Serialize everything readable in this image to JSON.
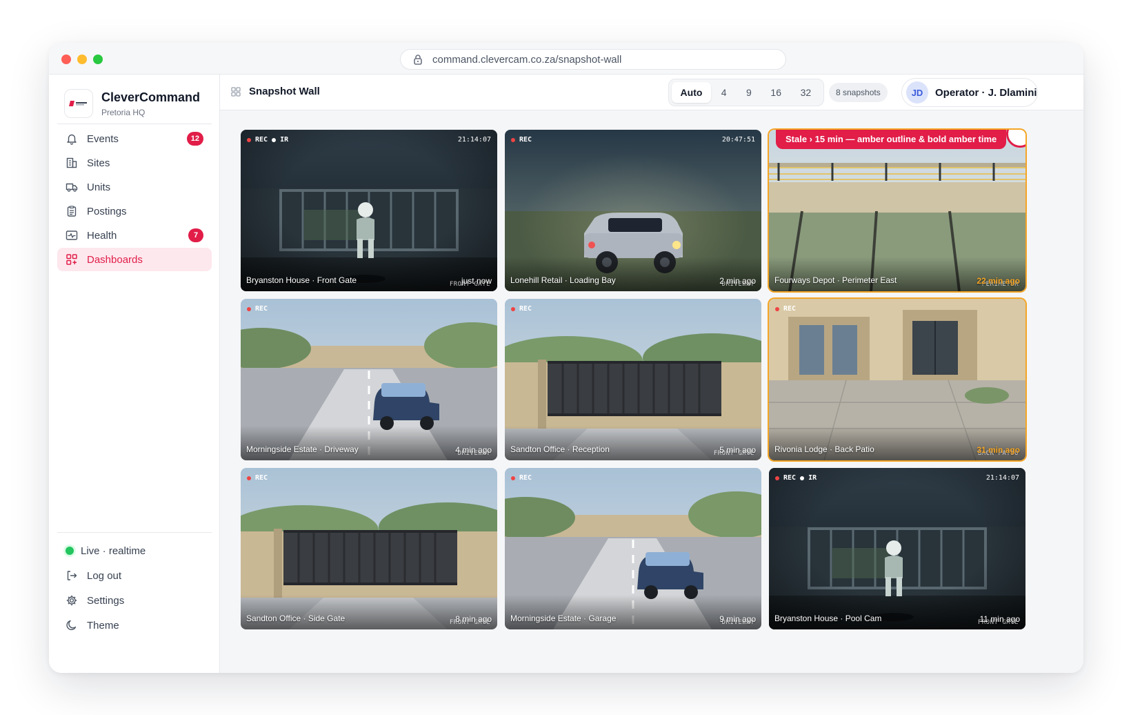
{
  "browser": {
    "url": "command.clevercam.co.za/snapshot-wall"
  },
  "brand": {
    "name": "CleverCommand",
    "subtitle": "Pretoria HQ"
  },
  "nav": [
    {
      "label": "Events",
      "icon": "bell-icon",
      "badge": "12",
      "active": false
    },
    {
      "label": "Sites",
      "icon": "building-icon",
      "badge": null,
      "active": false
    },
    {
      "label": "Units",
      "icon": "truck-icon",
      "badge": null,
      "active": false
    },
    {
      "label": "Postings",
      "icon": "clipboard-icon",
      "badge": null,
      "active": false
    },
    {
      "label": "Health",
      "icon": "pulse-icon",
      "badge": "7",
      "active": false
    },
    {
      "label": "Dashboards",
      "icon": "dashboard-grid-icon",
      "badge": null,
      "active": true
    }
  ],
  "footer": {
    "live": "Live · realtime",
    "logout": "Log out",
    "settings": "Settings",
    "theme": "Theme"
  },
  "page": {
    "title": "Snapshot Wall"
  },
  "layout_options": [
    "Auto",
    "4",
    "9",
    "16",
    "32"
  ],
  "layout_selected": "Auto",
  "snapshot_count": "8 snapshots",
  "operator": {
    "initials": "JD",
    "name": "Operator · J. Dlamini"
  },
  "stale_note": "Stale › 15 min — amber outline & bold amber time",
  "colors": {
    "accent": "#e11d48",
    "stale": "#f5a524",
    "live": "#22c55e"
  },
  "tiles": [
    {
      "name": "Bryanston House · Front Gate",
      "age": "just now",
      "zone": "FRONT GATE",
      "rec": "REC",
      "ir": "IR",
      "time": "21:14:07",
      "stale": false,
      "scene": "ir-gate"
    },
    {
      "name": "Lonehill Retail · Loading Bay",
      "age": "2 min ago",
      "zone": "DRIVEWAY",
      "rec": "REC",
      "ir": "",
      "time": "20:47:51",
      "stale": false,
      "scene": "night-car"
    },
    {
      "name": "Fourways Depot · Perimeter East",
      "age": "22 min ago",
      "zone": "PERIMETER",
      "rec": "",
      "ir": "",
      "time": "",
      "stale": true,
      "scene": "perimeter"
    },
    {
      "name": "Morningside Estate · Driveway",
      "age": "4 min ago",
      "zone": "DRIVEWAY",
      "rec": "REC",
      "ir": "",
      "time": "",
      "stale": false,
      "scene": "driveway"
    },
    {
      "name": "Sandton Office · Reception",
      "age": "5 min ago",
      "zone": "FRONT GATE",
      "rec": "REC",
      "ir": "",
      "time": "",
      "stale": false,
      "scene": "gate"
    },
    {
      "name": "Rivonia Lodge · Back Patio",
      "age": "31 min ago",
      "zone": "BACK PATIO",
      "rec": "REC",
      "ir": "",
      "time": "",
      "stale": true,
      "scene": "patio"
    },
    {
      "name": "Sandton Office · Side Gate",
      "age": "8 min ago",
      "zone": "FRONT GATE",
      "rec": "REC",
      "ir": "",
      "time": "",
      "stale": false,
      "scene": "gate"
    },
    {
      "name": "Morningside Estate · Garage",
      "age": "9 min ago",
      "zone": "DRIVEWAY",
      "rec": "REC",
      "ir": "",
      "time": "",
      "stale": false,
      "scene": "driveway"
    },
    {
      "name": "Bryanston House · Pool Cam",
      "age": "11 min ago",
      "zone": "FRONT GATE",
      "rec": "REC",
      "ir": "IR",
      "time": "21:14:07",
      "stale": false,
      "scene": "ir-gate"
    }
  ]
}
